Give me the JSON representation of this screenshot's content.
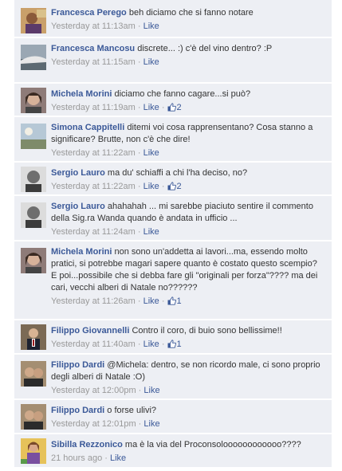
{
  "comments": [
    {
      "author": "Francesca Perego",
      "text": "beh diciamo che si fanno notare",
      "time": "Yesterday at 11:13am",
      "like": "Like",
      "likes": "",
      "avatar": "avatar-1"
    },
    {
      "author": "Francesca Mancosu",
      "text": "discrete... :) c'è del vino dentro? :P",
      "time": "Yesterday at 11:15am",
      "like": "Like",
      "likes": "",
      "avatar": "avatar-2"
    },
    {
      "author": "Michela Morini",
      "text": "diciamo che fanno cagare...si può?",
      "time": "Yesterday at 11:19am",
      "like": "Like",
      "likes": "2",
      "avatar": "avatar-3"
    },
    {
      "author": "Simona Cappitelli",
      "text": "ditemi voi cosa rapprensentano? Cosa stanno a significare? Brutte, non c'è che dire!",
      "time": "Yesterday at 11:22am",
      "like": "Like",
      "likes": "",
      "avatar": "avatar-4"
    },
    {
      "author": "Sergio Lauro",
      "text": "ma du' schiaffi a chi l'ha deciso, no?",
      "time": "Yesterday at 11:22am",
      "like": "Like",
      "likes": "2",
      "avatar": "avatar-5"
    },
    {
      "author": "Sergio Lauro",
      "text": "ahahahah ... mi sarebbe piaciuto sentire il commento della Sig.ra Wanda quando è andata in ufficio ...",
      "time": "Yesterday at 11:24am",
      "like": "Like",
      "likes": "",
      "avatar": "avatar-5"
    },
    {
      "author": "Michela Morini",
      "text": "non sono un'addetta ai lavori...ma, essendo molto pratici, si potrebbe magari sapere quanto è costato questo scempio? E poi...possibile che si debba fare gli \"originali per forza\"???? ma dei cari, vecchi alberi di Natale no??????",
      "time": "Yesterday at 11:26am",
      "like": "Like",
      "likes": "1",
      "avatar": "avatar-3"
    },
    {
      "author": "Filippo Giovannelli",
      "text": "Contro il coro, di buio sono bellissime!!",
      "time": "Yesterday at 11:40am",
      "like": "Like",
      "likes": "1",
      "avatar": "avatar-6"
    },
    {
      "author": "Filippo Dardi",
      "text": "@Michela: dentro, se non ricordo male, ci sono proprio degli alberi di Natale :O)",
      "time": "Yesterday at 12:00pm",
      "like": "Like",
      "likes": "",
      "avatar": "avatar-7"
    },
    {
      "author": "Filippo Dardi",
      "text": "o forse ulivi?",
      "time": "Yesterday at 12:01pm",
      "like": "Like",
      "likes": "",
      "avatar": "avatar-7"
    },
    {
      "author": "Sibilla Rezzonico",
      "text": "ma è la via del Proconsoloooooooooooo????",
      "time": "21 hours ago",
      "like": "Like",
      "likes": "",
      "avatar": "avatar-8"
    }
  ],
  "separator": " · ",
  "colors": {
    "background": "#edeff4",
    "link": "#3b5998",
    "meta": "#999999",
    "text": "#333333"
  }
}
